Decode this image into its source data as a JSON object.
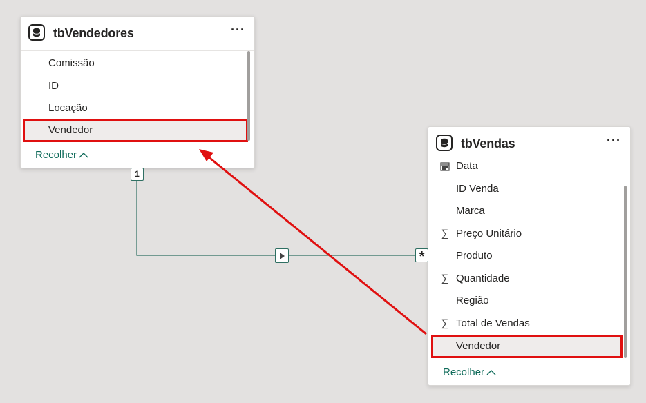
{
  "vendedores": {
    "title": "tbVendedores",
    "more_label": "···",
    "fields": [
      "Comissão",
      "ID",
      "Locação",
      "Vendedor"
    ],
    "highlighted_field": "Vendedor",
    "collapse_label": "Recolher"
  },
  "vendas": {
    "title": "tbVendas",
    "more_label": "···",
    "fields": [
      {
        "label": "Data",
        "icon": "calendar-icon"
      },
      {
        "label": "ID Venda",
        "icon": ""
      },
      {
        "label": "Marca",
        "icon": ""
      },
      {
        "label": "Preço Unitário",
        "icon": "sigma-icon"
      },
      {
        "label": "Produto",
        "icon": ""
      },
      {
        "label": "Quantidade",
        "icon": "sigma-icon"
      },
      {
        "label": "Região",
        "icon": ""
      },
      {
        "label": "Total de Vendas",
        "icon": "sigma-icon"
      },
      {
        "label": "Vendedor",
        "icon": ""
      }
    ],
    "highlighted_field": "Vendedor",
    "collapse_label": "Recolher"
  },
  "relationship": {
    "one_side": "1",
    "many_side": "*",
    "direction_icon": "triangle-right-icon"
  },
  "colors": {
    "highlight": "#e01010",
    "relationship_line": "#2f6f62",
    "collapse_link": "#0f6b5a"
  }
}
